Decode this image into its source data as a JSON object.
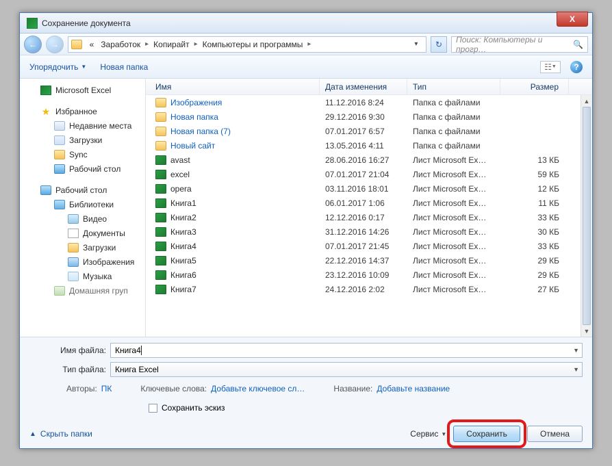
{
  "window": {
    "title": "Сохранение документа",
    "close": "X"
  },
  "nav": {
    "back": "←",
    "fwd": "→",
    "crumbs": [
      "«",
      "Заработок",
      "Копирайт",
      "Компьютеры и программы"
    ],
    "search_placeholder": "Поиск: Компьютеры и прогр…"
  },
  "toolbar": {
    "organize": "Упорядочить",
    "newfolder": "Новая папка"
  },
  "sidebar": {
    "excel": "Microsoft Excel",
    "fav": "Избранное",
    "recent": "Недавние места",
    "downloads": "Загрузки",
    "sync": "Sync",
    "desktop1": "Рабочий стол",
    "desktop2": "Рабочий стол",
    "libraries": "Библиотеки",
    "video": "Видео",
    "documents": "Документы",
    "downloads2": "Загрузки",
    "images": "Изображения",
    "music": "Музыка",
    "homegroup": "Домашняя груп"
  },
  "columns": {
    "name": "Имя",
    "date": "Дата изменения",
    "type": "Тип",
    "size": "Размер"
  },
  "type_folder": "Папка с файлами",
  "type_excel": "Лист Microsoft Ex…",
  "files": [
    {
      "icon": "folder",
      "name": "Изображения",
      "link": true,
      "date": "11.12.2016 8:24",
      "type": "folder",
      "size": ""
    },
    {
      "icon": "folder",
      "name": "Новая папка",
      "link": true,
      "date": "29.12.2016 9:30",
      "type": "folder",
      "size": ""
    },
    {
      "icon": "folder",
      "name": "Новая папка (7)",
      "link": true,
      "date": "07.01.2017 6:57",
      "type": "folder",
      "size": ""
    },
    {
      "icon": "folder",
      "name": "Новый сайт",
      "link": true,
      "date": "13.05.2016 4:11",
      "type": "folder",
      "size": ""
    },
    {
      "icon": "xls",
      "name": "avast",
      "link": false,
      "date": "28.06.2016 16:27",
      "type": "excel",
      "size": "13 КБ"
    },
    {
      "icon": "xls",
      "name": "excel",
      "link": false,
      "date": "07.01.2017 21:04",
      "type": "excel",
      "size": "59 КБ"
    },
    {
      "icon": "xls",
      "name": "opera",
      "link": false,
      "date": "03.11.2016 18:01",
      "type": "excel",
      "size": "12 КБ"
    },
    {
      "icon": "xls",
      "name": "Книга1",
      "link": false,
      "date": "06.01.2017 1:06",
      "type": "excel",
      "size": "11 КБ"
    },
    {
      "icon": "xls",
      "name": "Книга2",
      "link": false,
      "date": "12.12.2016 0:17",
      "type": "excel",
      "size": "33 КБ"
    },
    {
      "icon": "xls",
      "name": "Книга3",
      "link": false,
      "date": "31.12.2016 14:26",
      "type": "excel",
      "size": "30 КБ"
    },
    {
      "icon": "xls",
      "name": "Книга4",
      "link": false,
      "date": "07.01.2017 21:45",
      "type": "excel",
      "size": "33 КБ"
    },
    {
      "icon": "xls",
      "name": "Книга5",
      "link": false,
      "date": "22.12.2016 14:37",
      "type": "excel",
      "size": "29 КБ"
    },
    {
      "icon": "xls",
      "name": "Книга6",
      "link": false,
      "date": "23.12.2016 10:09",
      "type": "excel",
      "size": "29 КБ"
    },
    {
      "icon": "xls",
      "name": "Книга7",
      "link": false,
      "date": "24.12.2016 2:02",
      "type": "excel",
      "size": "27 КБ"
    }
  ],
  "filename_label": "Имя файла:",
  "filename_value": "Книга4",
  "filetype_label": "Тип файла:",
  "filetype_value": "Книга Excel",
  "meta": {
    "authors_label": "Авторы:",
    "authors_value": "ПК",
    "keywords_label": "Ключевые слова:",
    "keywords_value": "Добавьте ключевое сл…",
    "title_label": "Название:",
    "title_value": "Добавьте название"
  },
  "save_thumb": "Сохранить эскиз",
  "hide_folders": "Скрыть папки",
  "service": "Сервис",
  "save": "Сохранить",
  "cancel": "Отмена"
}
